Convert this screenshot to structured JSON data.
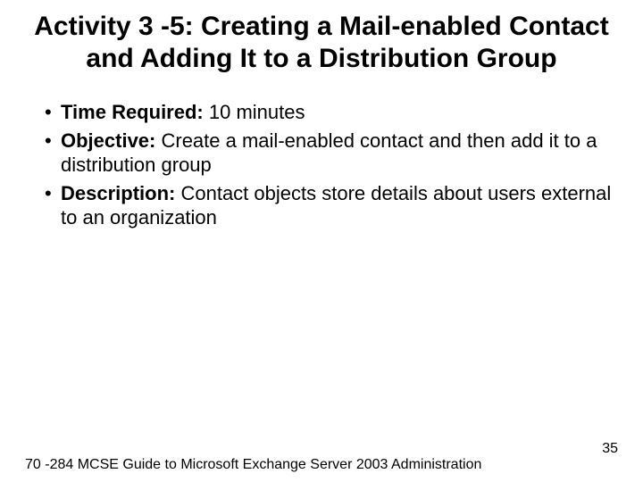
{
  "title": "Activity 3 -5: Creating a Mail-enabled Contact and Adding It to a Distribution Group",
  "bullets": [
    {
      "label": "Time Required: ",
      "text": "10 minutes"
    },
    {
      "label": "Objective: ",
      "text": "Create a mail-enabled contact and then add it to a distribution group"
    },
    {
      "label": "Description: ",
      "text": "Contact objects store details about users external to an organization"
    }
  ],
  "footer": {
    "left": "70 -284 MCSE Guide to Microsoft Exchange Server 2003 Administration",
    "page": "35"
  }
}
